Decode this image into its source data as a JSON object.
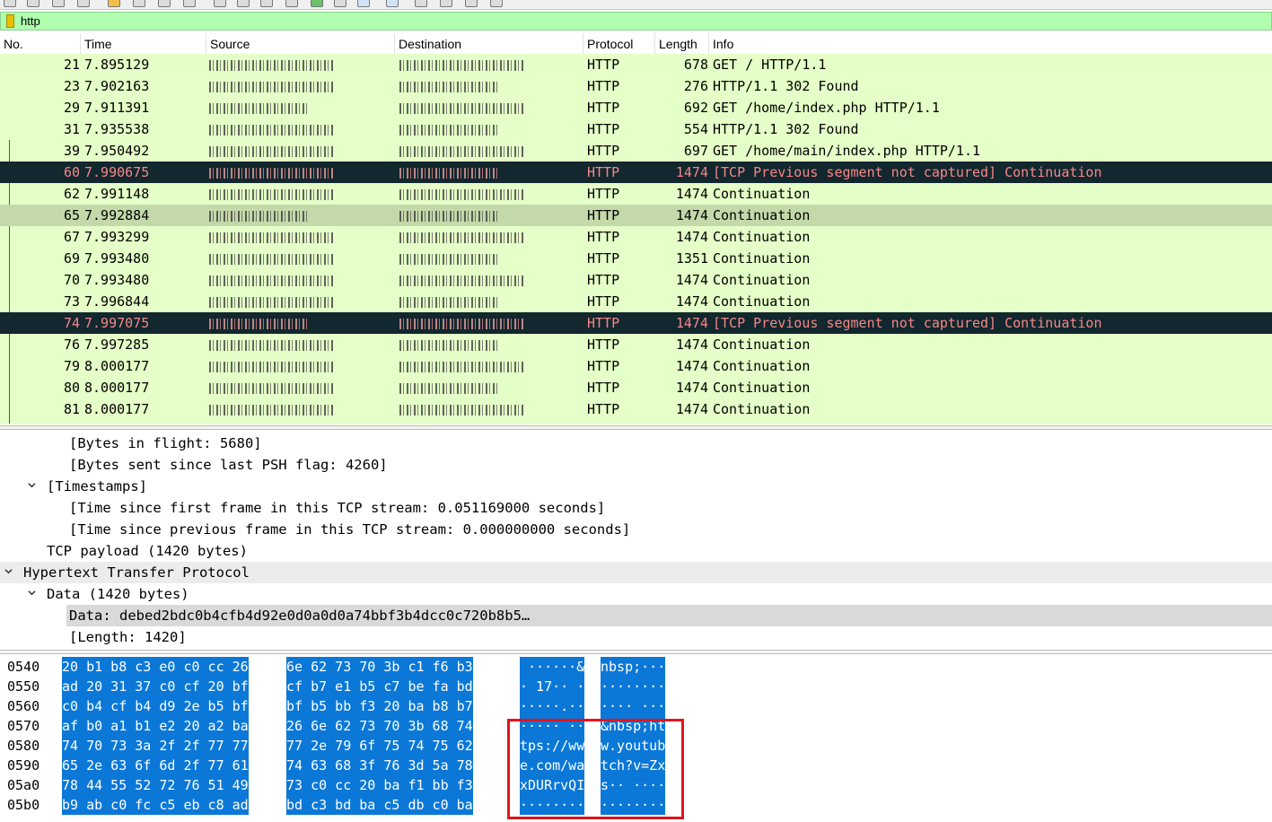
{
  "filter": {
    "value": "http"
  },
  "columns": [
    {
      "key": "no",
      "label": "No."
    },
    {
      "key": "time",
      "label": "Time"
    },
    {
      "key": "src",
      "label": "Source"
    },
    {
      "key": "dst",
      "label": "Destination"
    },
    {
      "key": "proto",
      "label": "Protocol"
    },
    {
      "key": "len",
      "label": "Length"
    },
    {
      "key": "info",
      "label": "Info"
    }
  ],
  "packets": [
    {
      "no": "21",
      "time": "7.895129",
      "proto": "HTTP",
      "len": "678",
      "info": "GET / HTTP/1.1",
      "state": "normal"
    },
    {
      "no": "23",
      "time": "7.902163",
      "proto": "HTTP",
      "len": "276",
      "info": "HTTP/1.1 302 Found",
      "state": "normal"
    },
    {
      "no": "29",
      "time": "7.911391",
      "proto": "HTTP",
      "len": "692",
      "info": "GET /home/index.php HTTP/1.1",
      "state": "normal"
    },
    {
      "no": "31",
      "time": "7.935538",
      "proto": "HTTP",
      "len": "554",
      "info": "HTTP/1.1 302 Found",
      "state": "normal"
    },
    {
      "no": "39",
      "time": "7.950492",
      "proto": "HTTP",
      "len": "697",
      "info": "GET /home/main/index.php HTTP/1.1",
      "state": "normal"
    },
    {
      "no": "60",
      "time": "7.990675",
      "proto": "HTTP",
      "len": "1474",
      "info": "[TCP Previous segment not captured] Continuation",
      "state": "error"
    },
    {
      "no": "62",
      "time": "7.991148",
      "proto": "HTTP",
      "len": "1474",
      "info": "Continuation",
      "state": "normal"
    },
    {
      "no": "65",
      "time": "7.992884",
      "proto": "HTTP",
      "len": "1474",
      "info": "Continuation",
      "state": "selected"
    },
    {
      "no": "67",
      "time": "7.993299",
      "proto": "HTTP",
      "len": "1474",
      "info": "Continuation",
      "state": "normal"
    },
    {
      "no": "69",
      "time": "7.993480",
      "proto": "HTTP",
      "len": "1351",
      "info": "Continuation",
      "state": "normal"
    },
    {
      "no": "70",
      "time": "7.993480",
      "proto": "HTTP",
      "len": "1474",
      "info": "Continuation",
      "state": "normal"
    },
    {
      "no": "73",
      "time": "7.996844",
      "proto": "HTTP",
      "len": "1474",
      "info": "Continuation",
      "state": "normal"
    },
    {
      "no": "74",
      "time": "7.997075",
      "proto": "HTTP",
      "len": "1474",
      "info": "[TCP Previous segment not captured] Continuation",
      "state": "error"
    },
    {
      "no": "76",
      "time": "7.997285",
      "proto": "HTTP",
      "len": "1474",
      "info": "Continuation",
      "state": "normal"
    },
    {
      "no": "79",
      "time": "8.000177",
      "proto": "HTTP",
      "len": "1474",
      "info": "Continuation",
      "state": "normal"
    },
    {
      "no": "80",
      "time": "8.000177",
      "proto": "HTTP",
      "len": "1474",
      "info": "Continuation",
      "state": "normal"
    },
    {
      "no": "81",
      "time": "8.000177",
      "proto": "HTTP",
      "len": "1474",
      "info": "Continuation",
      "state": "normal"
    }
  ],
  "details": [
    {
      "text": "[Bytes in flight: 5680]",
      "level": 3,
      "expander": "none"
    },
    {
      "text": "[Bytes sent since last PSH flag: 4260]",
      "level": 3,
      "expander": "none"
    },
    {
      "text": "[Timestamps]",
      "level": 2,
      "expander": "open"
    },
    {
      "text": "[Time since first frame in this TCP stream: 0.051169000 seconds]",
      "level": 3,
      "expander": "none"
    },
    {
      "text": "[Time since previous frame in this TCP stream: 0.000000000 seconds]",
      "level": 3,
      "expander": "none"
    },
    {
      "text": "TCP payload (1420 bytes)",
      "level": 2,
      "expander": "none"
    },
    {
      "text": "Hypertext Transfer Protocol",
      "level": 1,
      "expander": "open",
      "highlight": true
    },
    {
      "text": "Data (1420 bytes)",
      "level": 2,
      "expander": "open"
    },
    {
      "text": "Data: debed2bdc0b4cfb4d92e0d0a0d0a74bbf3b4dcc0c720b8b5…",
      "level": 3,
      "expander": "none",
      "selected": true
    },
    {
      "text": "[Length: 1420]",
      "level": 3,
      "expander": "none"
    }
  ],
  "bytes": [
    {
      "offset": "0540",
      "hexA": "20 b1 b8 c3 e0 c0 cc 26",
      "hexB": "6e 62 73 70 3b c1 f6 b3",
      "ascA": " ······&",
      "ascB": "nbsp;···"
    },
    {
      "offset": "0550",
      "hexA": "ad 20 31 37 c0 cf 20 bf",
      "hexB": "cf b7 e1 b5 c7 be fa bd",
      "ascA": "· 17·· ·",
      "ascB": "········"
    },
    {
      "offset": "0560",
      "hexA": "c0 b4 cf b4 d9 2e b5 bf",
      "hexB": "bf b5 bb f3 20 ba b8 b7",
      "ascA": "·····.··",
      "ascB": "···· ···"
    },
    {
      "offset": "0570",
      "hexA": "af b0 a1 b1 e2 20 a2 ba",
      "hexB": "26 6e 62 73 70 3b 68 74",
      "ascA": "····· ··",
      "ascB": "&nbsp;ht"
    },
    {
      "offset": "0580",
      "hexA": "74 70 73 3a 2f 2f 77 77",
      "hexB": "77 2e 79 6f 75 74 75 62",
      "ascA": "tps://ww",
      "ascB": "w.youtub"
    },
    {
      "offset": "0590",
      "hexA": "65 2e 63 6f 6d 2f 77 61",
      "hexB": "74 63 68 3f 76 3d 5a 78",
      "ascA": "e.com/wa",
      "ascB": "tch?v=Zx"
    },
    {
      "offset": "05a0",
      "hexA": "78 44 55 52 72 76 51 49",
      "hexB": "73 c0 cc 20 ba f1 bb f3",
      "ascA": "xDURrvQI",
      "ascB": "s·· ····"
    },
    {
      "offset": "05b0",
      "hexA": "b9 ab c0 fc c5 eb c8 ad",
      "hexB": "bd c3 bd ba c5 db c0 ba",
      "ascA": "········",
      "ascB": "········"
    }
  ],
  "colors": {
    "filter_bg": "#afffaf",
    "row_bg": "#e4ffc7",
    "row_selected": "#c4d9aa",
    "error_bg": "#12272e",
    "error_fg": "#f78787",
    "bytes_highlight": "#0b78d8",
    "annotation": "#e0141e"
  }
}
